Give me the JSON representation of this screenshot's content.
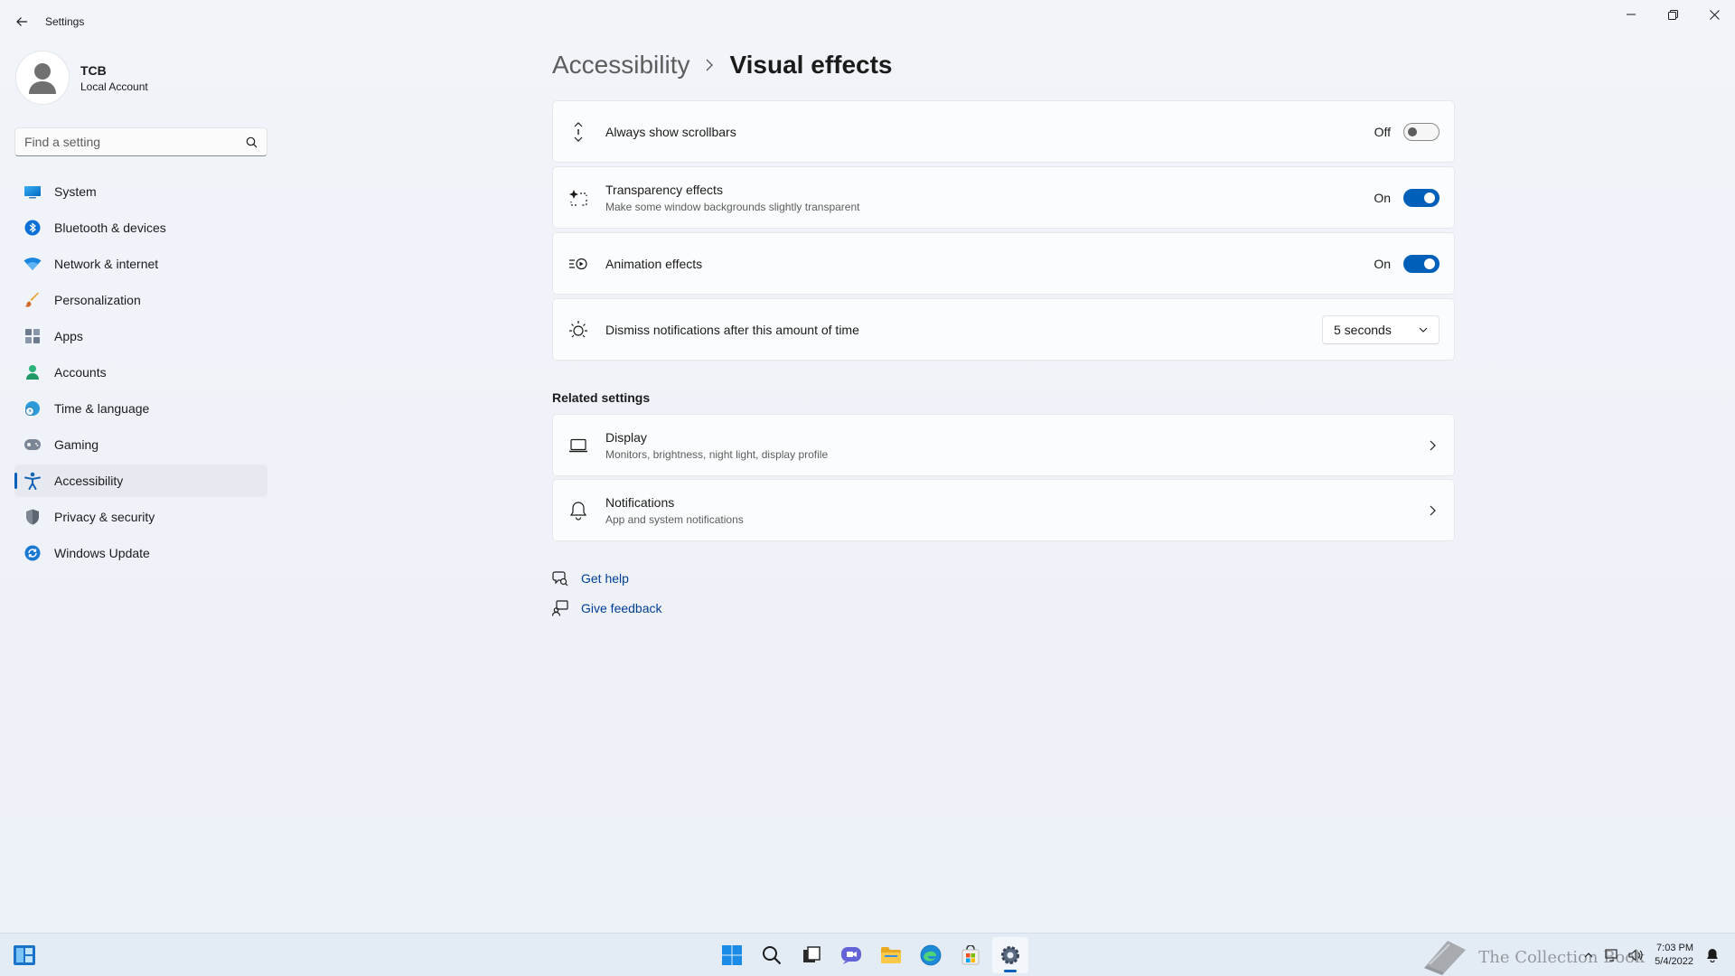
{
  "app": {
    "title": "Settings"
  },
  "profile": {
    "name": "TCB",
    "account_type": "Local Account"
  },
  "search": {
    "placeholder": "Find a setting"
  },
  "nav": {
    "items": [
      {
        "label": "System",
        "icon": "monitor-icon"
      },
      {
        "label": "Bluetooth & devices",
        "icon": "bluetooth-icon"
      },
      {
        "label": "Network & internet",
        "icon": "wifi-icon"
      },
      {
        "label": "Personalization",
        "icon": "brush-icon"
      },
      {
        "label": "Apps",
        "icon": "apps-icon"
      },
      {
        "label": "Accounts",
        "icon": "person-icon"
      },
      {
        "label": "Time & language",
        "icon": "globe-clock-icon"
      },
      {
        "label": "Gaming",
        "icon": "gamepad-icon"
      },
      {
        "label": "Accessibility",
        "icon": "accessibility-icon",
        "active": true
      },
      {
        "label": "Privacy & security",
        "icon": "shield-icon"
      },
      {
        "label": "Windows Update",
        "icon": "update-icon"
      }
    ]
  },
  "breadcrumb": {
    "parent": "Accessibility",
    "current": "Visual effects"
  },
  "settings": {
    "scrollbars": {
      "title": "Always show scrollbars",
      "state_label": "Off",
      "on": false
    },
    "transparency": {
      "title": "Transparency effects",
      "subtitle": "Make some window backgrounds slightly transparent",
      "state_label": "On",
      "on": true
    },
    "animation": {
      "title": "Animation effects",
      "state_label": "On",
      "on": true
    },
    "dismiss": {
      "title": "Dismiss notifications after this amount of time",
      "value": "5 seconds"
    }
  },
  "related": {
    "heading": "Related settings",
    "display": {
      "title": "Display",
      "subtitle": "Monitors, brightness, night light, display profile"
    },
    "notifications": {
      "title": "Notifications",
      "subtitle": "App and system notifications"
    }
  },
  "help": {
    "get_help": "Get help",
    "give_feedback": "Give feedback"
  },
  "taskbar": {
    "time": "7:03 PM",
    "date": "5/4/2022",
    "watermark": "The Collection Book"
  },
  "colors": {
    "accent": "#005fb8",
    "link": "#003e92"
  }
}
